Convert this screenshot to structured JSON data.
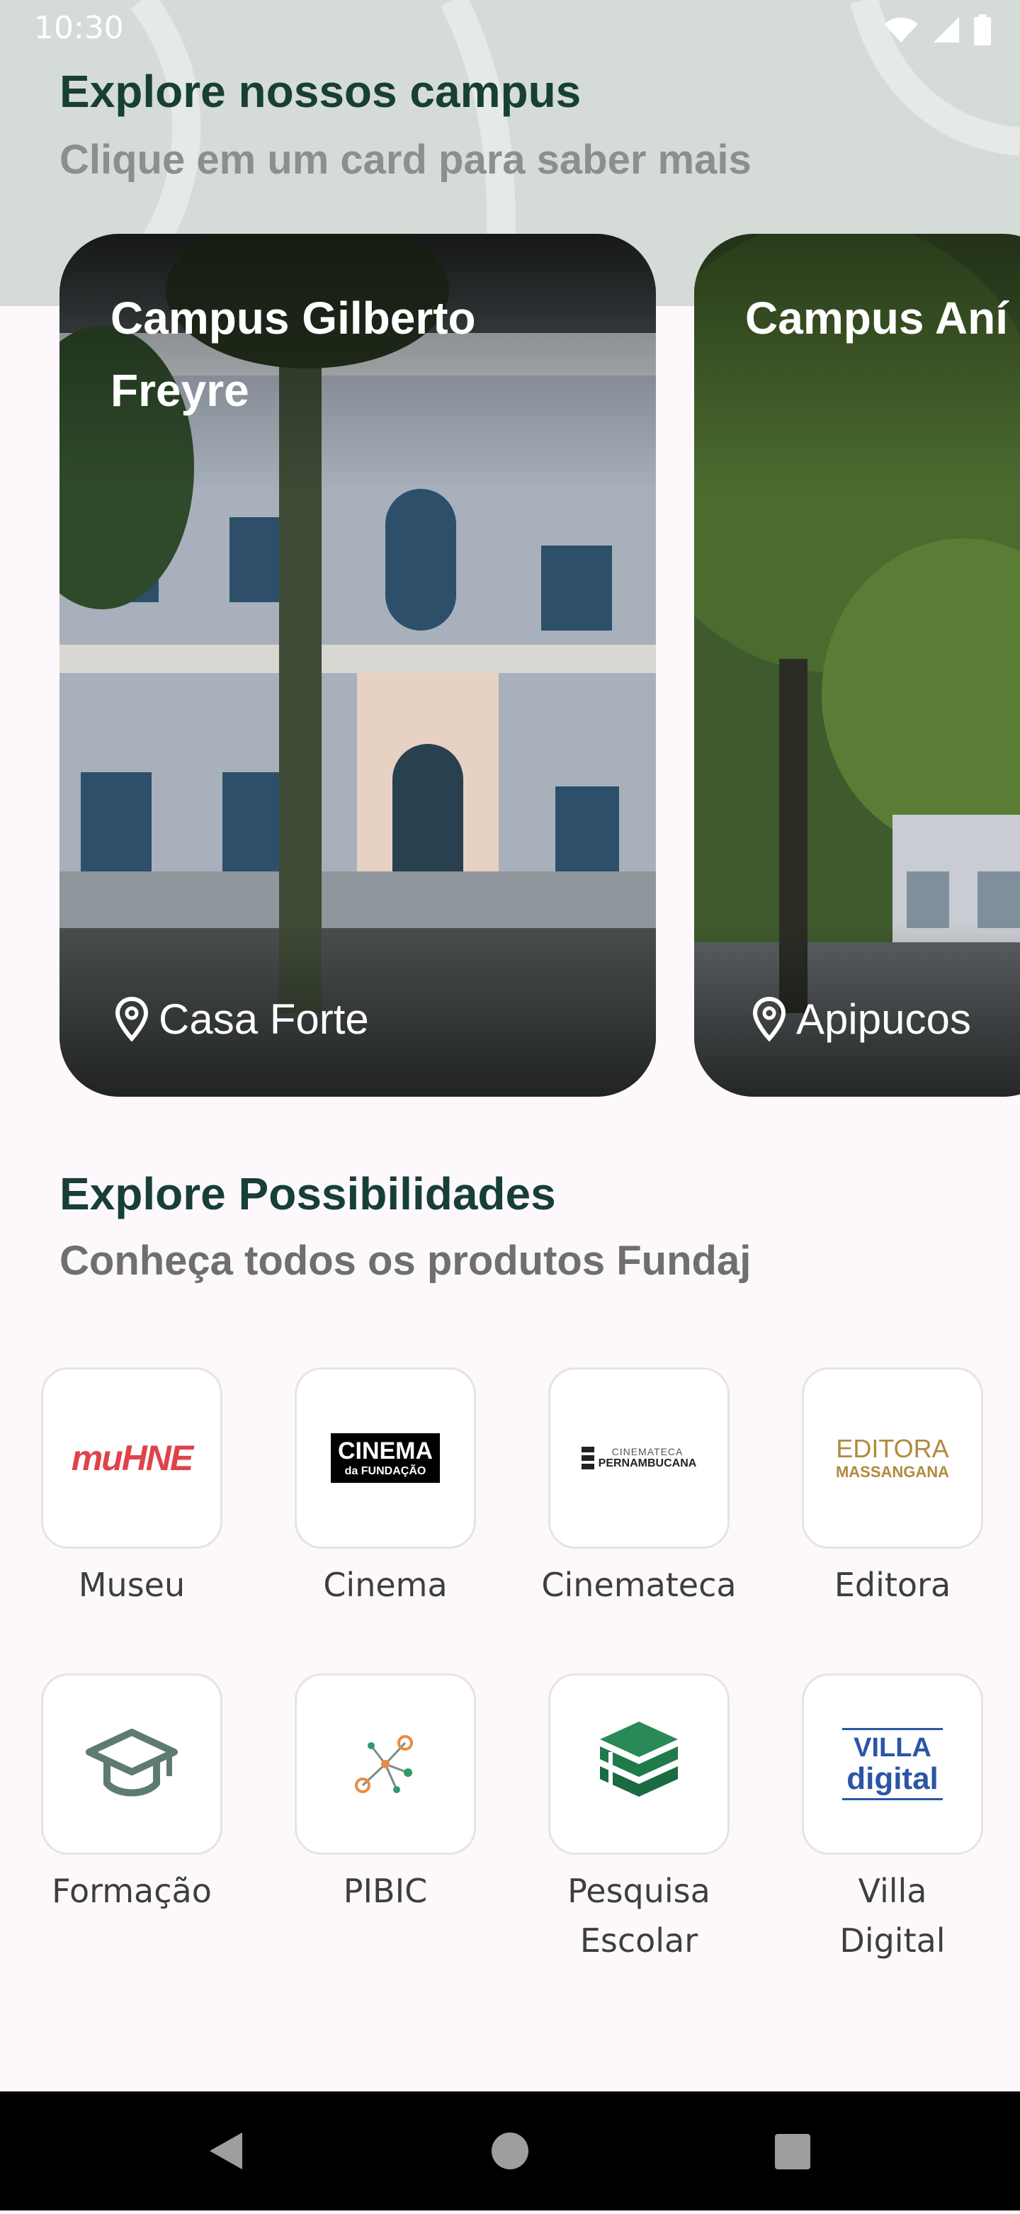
{
  "status_bar": {
    "time": "10:30"
  },
  "header": {
    "title": "Explore nossos campus",
    "subtitle": "Clique em um card para saber mais"
  },
  "campus_cards": [
    {
      "name": "Campus Gilberto Freyre",
      "location": "Casa Forte"
    },
    {
      "name": "Campus Aní Teixeira",
      "location": "Apipucos"
    }
  ],
  "products_section": {
    "title": "Explore Possibilidades",
    "subtitle": "Conheça todos os produtos Fundaj"
  },
  "products": [
    {
      "label": "Museu",
      "logo_text": "muHNE"
    },
    {
      "label": "Cinema",
      "logo_text": "CINEMA",
      "logo_subtext": "da FUNDAÇÃO"
    },
    {
      "label": "Cinemateca",
      "logo_text": "CINEMATECA",
      "logo_subtext": "PERNAMBUCANA"
    },
    {
      "label": "Editora",
      "logo_text": "EDITORA",
      "logo_subtext": "MASSANGANA"
    },
    {
      "label": "Formação"
    },
    {
      "label": "PIBIC"
    },
    {
      "label": "Pesquisa Escolar"
    },
    {
      "label": "Villa Digital",
      "logo_text": "VILLA",
      "logo_subtext": "digital"
    }
  ],
  "colors": {
    "brand_dark_green": "#173f35",
    "header_bg": "#d5dcd8",
    "page_bg": "#fcf8fb",
    "muhne_red": "#e0424a",
    "editora_gold": "#b08a3e",
    "villa_blue": "#2c55a6",
    "pesquisa_green": "#1f7a4c"
  },
  "nav_bar": {
    "icons": [
      "back-icon",
      "home-icon",
      "recents-icon"
    ]
  }
}
